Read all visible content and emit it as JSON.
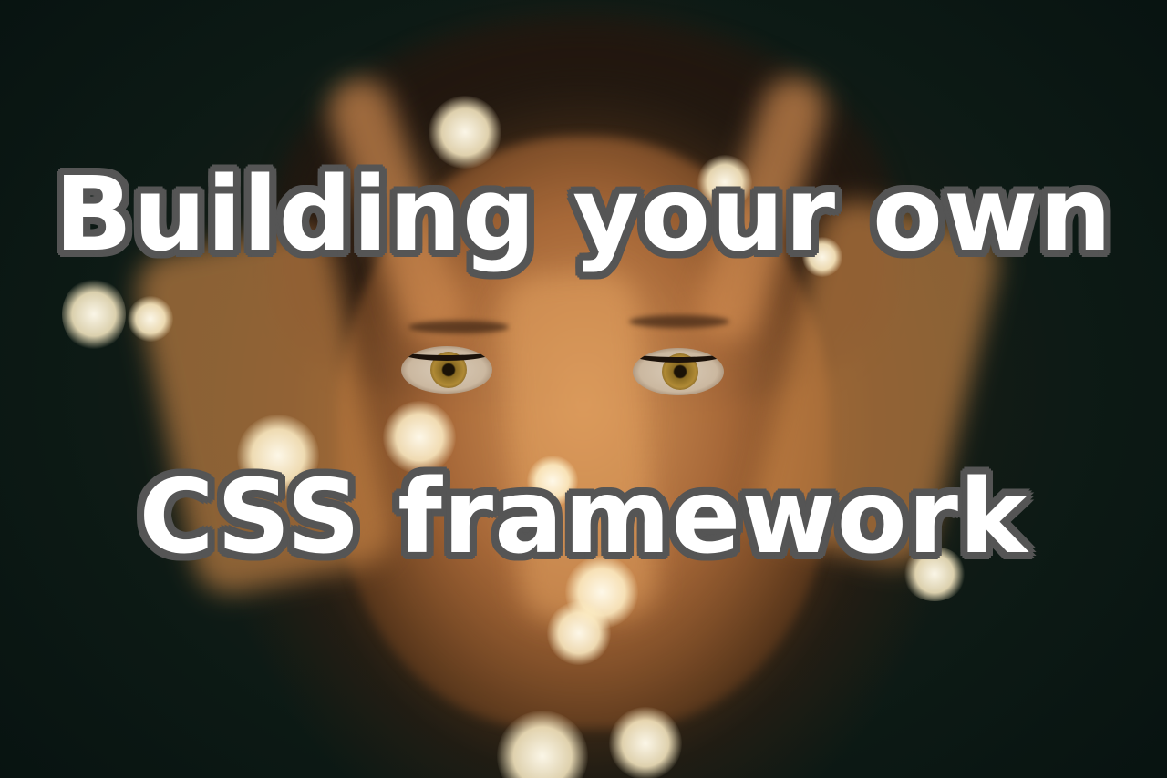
{
  "headline": {
    "line1": "Building your own",
    "line2": "CSS framework"
  },
  "colors": {
    "text_fill": "#ffffff",
    "text_outline": "#555555",
    "background": "#0b1612",
    "warm_light": "#fff4d6"
  }
}
